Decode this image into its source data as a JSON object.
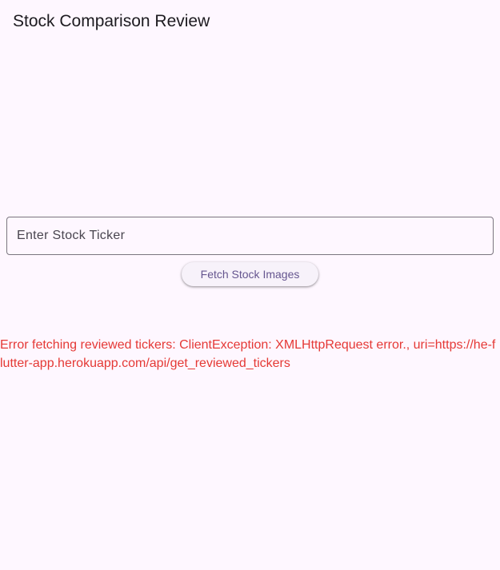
{
  "app_bar": {
    "title": "Stock Comparison Review"
  },
  "ticker_input": {
    "value": "",
    "placeholder": "Enter Stock Ticker"
  },
  "fetch_button": {
    "label": "Fetch Stock Images"
  },
  "error": {
    "message": "Error fetching reviewed tickers: ClientException: XMLHttpRequest error., uri=https://he-flutter-app.herokuapp.com/api/get_reviewed_tickers"
  },
  "colors": {
    "background": "#fef7ff",
    "error": "#e53935",
    "button_text": "#65558f",
    "outline": "#7a757f"
  }
}
